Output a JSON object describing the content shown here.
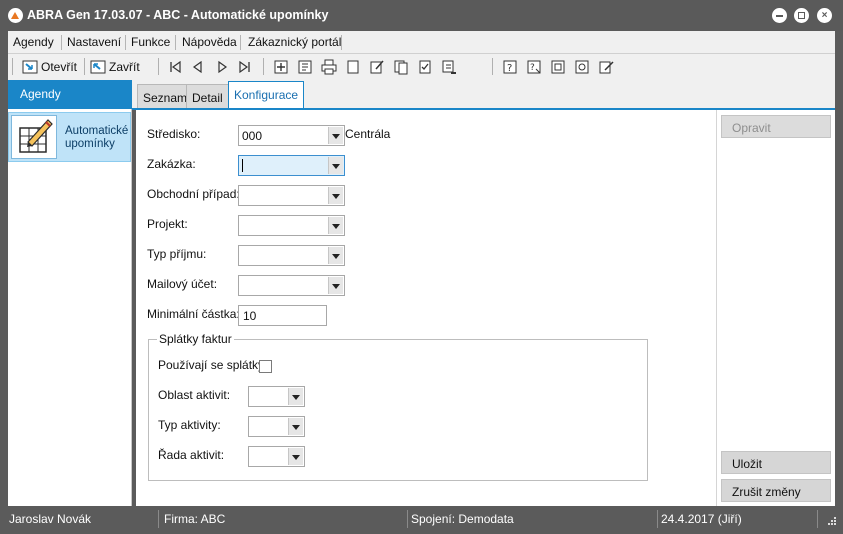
{
  "window": {
    "title": "ABRA Gen 17.03.07 - ABC - Automatické upomínky",
    "close_glyph": "×"
  },
  "menu": {
    "items": [
      "Agendy",
      "Nastavení",
      "Funkce",
      "Nápověda",
      "Zákaznický portál"
    ]
  },
  "toolbar": {
    "open_label": "Otevřít",
    "close_label": "Zavřít"
  },
  "agenda": {
    "header": "Agendy",
    "item_label": "Automatické upomínky"
  },
  "tabs": [
    {
      "label": "Seznam",
      "active": false
    },
    {
      "label": "Detail",
      "active": false
    },
    {
      "label": "Konfigurace",
      "active": true
    }
  ],
  "form": {
    "stredisko_label": "Středisko:",
    "stredisko_value": "000",
    "stredisko_name": "Centrála",
    "zakazka_label": "Zakázka:",
    "zakazka_value": "",
    "obchodni_pripad_label": "Obchodní případ:",
    "obchodni_pripad_value": "",
    "projekt_label": "Projekt:",
    "projekt_value": "",
    "typ_prijmu_label": "Typ příjmu:",
    "typ_prijmu_value": "",
    "mailovy_ucet_label": "Mailový účet:",
    "mailovy_ucet_value": "",
    "min_castka_label": "Minimální částka:",
    "min_castka_value": "10"
  },
  "splatky": {
    "title": "Splátky faktur",
    "pouzivaji_label": "Používají se splátky",
    "pouzivaji_checked": false,
    "oblast_label": "Oblast aktivit:",
    "typ_aktivity_label": "Typ aktivity:",
    "rada_aktivit_label": "Řada aktivit:"
  },
  "actions": {
    "edit_label": "Opravit",
    "save_label": "Uložit",
    "cancel_label": "Zrušit změny"
  },
  "status": {
    "user": "Jaroslav Novák",
    "firm": "Firma: ABC",
    "connection": "Spojení: Demodata",
    "date": "24.4.2017 (Jiří)"
  },
  "colors": {
    "accent": "#1a86c8",
    "chrome": "#5b5b5b",
    "selected_agenda": "#bfe3f8"
  }
}
